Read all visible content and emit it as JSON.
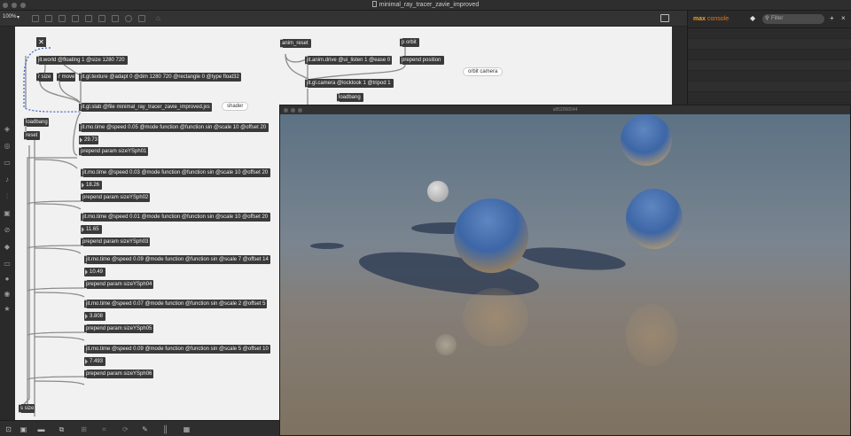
{
  "window": {
    "title": "minimal_ray_tracer_zavie_improved"
  },
  "toolbar": {
    "zoom": "100%"
  },
  "patcher": {
    "objects": {
      "jit_world": "jit.world @floating 1 @size 1280 720",
      "r_size": "r size",
      "r_move": "r move",
      "jit_gl_texture": "jit.gl.texture @adapt 0 @dim 1280 720 @rectangle 0 @type float32",
      "jit_gl_slab": "jit.gl.slab @file minimal_ray_tracer_zavie_improved.jxs",
      "anim_reset": "anim_reset",
      "jit_anim_drive": "jit.anim.drive @ui_listen 1 @ease 0",
      "p_orbit": "p orbit",
      "prepend_position": "prepend position",
      "jit_gl_camera": "jit.gl.camera @locklook 1 @tripod 1",
      "loadbang_top": "loadbang",
      "loadbang_left": "loadbang",
      "reset": "reset",
      "s_size": "s size"
    },
    "comments": {
      "shader": "shader",
      "orbit_camera": "orbit camera"
    },
    "chains": [
      {
        "mo": "jit.mo.time @speed 0.05 @mode function @function sin @scale 10 @offset 20",
        "value": "29.73",
        "prepend": "prepend param sizeYSph01"
      },
      {
        "mo": "jit.mo.time @speed 0.03 @mode function @function sin @scale 10 @offset 20",
        "value": "18.26",
        "prepend": "prepend param sizeYSph02"
      },
      {
        "mo": "jit.mo.time @speed 0.01 @mode function @function sin @scale 10 @offset 20",
        "value": "11.65",
        "prepend": "prepend param sizeYSph03"
      },
      {
        "mo": "jit.mo.time @speed 0.09 @mode function @function sin @scale 7 @offset 14",
        "value": "10.49",
        "prepend": "prepend param sizeYSph04"
      },
      {
        "mo": "jit.mo.time @speed 0.07 @mode function @function sin @scale 2 @offset 5",
        "value": "3.808",
        "prepend": "prepend param sizeYSph05"
      },
      {
        "mo": "jit.mo.time @speed 0.09 @mode function @function sin @scale 5 @offset 10",
        "value": "7.493",
        "prepend": "prepend param sizeYSph06"
      }
    ]
  },
  "render_window": {
    "title": "u852006544"
  },
  "console": {
    "title_max": "max",
    "title_console": "console",
    "filter_placeholder": "Filter",
    "add_label": "+",
    "close_label": "×"
  },
  "colors": {
    "accent": "#f0a020",
    "object_bg": "#3a3a3a",
    "canvas_bg": "#f1f1f1"
  }
}
